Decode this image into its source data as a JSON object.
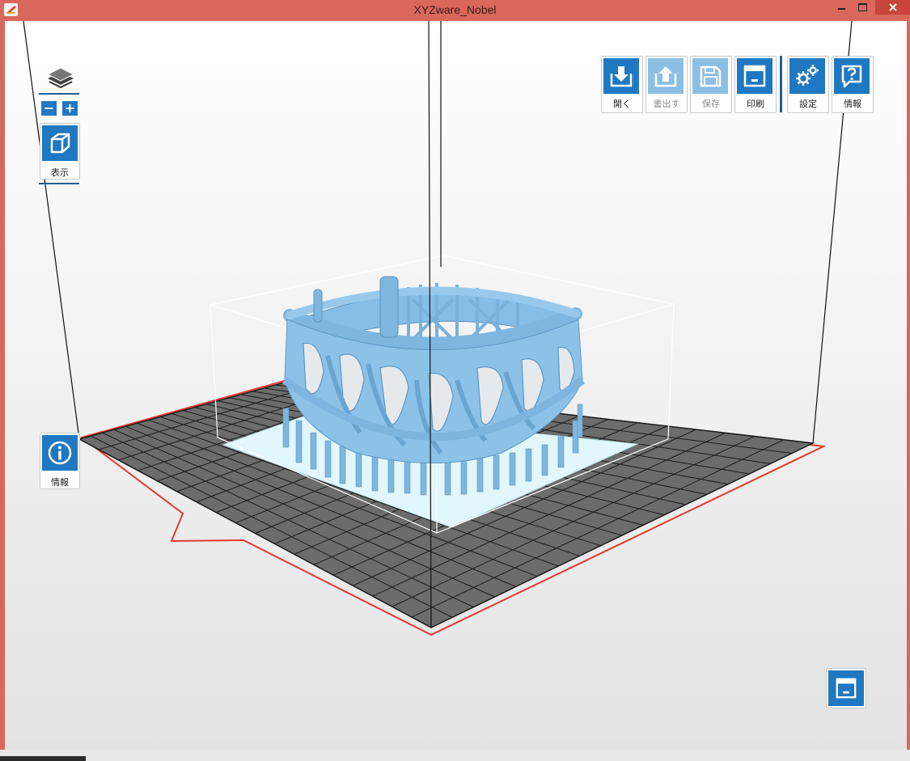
{
  "window": {
    "title": "XYZware_Nobel"
  },
  "toolbar": {
    "open_label": "開く",
    "export_label": "書出す",
    "save_label": "保存",
    "print_label": "印刷",
    "settings_label": "設定",
    "help_label": "情報"
  },
  "left_panel": {
    "view_label": "表示",
    "info_label": "情報",
    "zoom_out": "−",
    "zoom_in": "+"
  },
  "colors": {
    "model": "#8cc2e8",
    "accent": "#1f78c1",
    "boundary": "#e53935",
    "title_bar": "#d9675c"
  },
  "icons": {
    "open": "download-icon",
    "export": "upload-icon",
    "save": "floppy-icon",
    "print": "printer-icon",
    "settings": "gear-icon",
    "help": "question-icon",
    "view": "cube-icon",
    "info": "info-icon",
    "layers": "layers-icon",
    "print_preview": "print-preview-icon"
  }
}
